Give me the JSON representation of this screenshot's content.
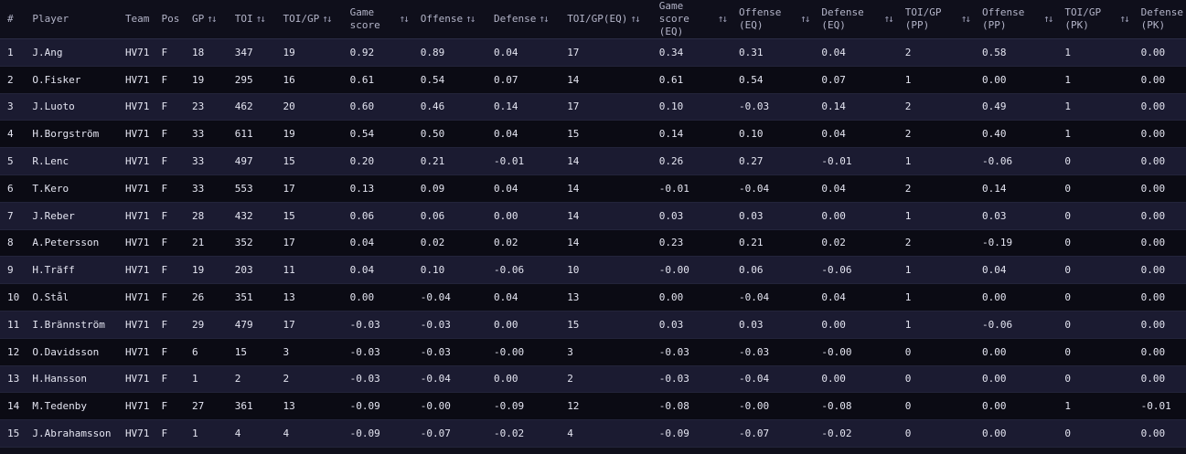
{
  "columns": [
    {
      "key": "rank",
      "label": "#",
      "sort": false
    },
    {
      "key": "player",
      "label": "Player",
      "sort": false
    },
    {
      "key": "team",
      "label": "Team",
      "sort": false
    },
    {
      "key": "pos",
      "label": "Pos",
      "sort": false
    },
    {
      "key": "gp",
      "label": "GP",
      "sort": true
    },
    {
      "key": "toi",
      "label": "TOI",
      "sort": true
    },
    {
      "key": "toi_gp",
      "label": "TOI/GP",
      "sort": true
    },
    {
      "key": "game_score",
      "label": "Game\nscore",
      "sort": true
    },
    {
      "key": "offense",
      "label": "Offense",
      "sort": true
    },
    {
      "key": "defense",
      "label": "Defense",
      "sort": true
    },
    {
      "key": "toi_gp_eq",
      "label": "TOI/GP(EQ)",
      "sort": true
    },
    {
      "key": "game_score_eq",
      "label": "Game\nscore\n(EQ)",
      "sort": true
    },
    {
      "key": "offense_eq",
      "label": "Offense\n(EQ)",
      "sort": true
    },
    {
      "key": "defense_eq",
      "label": "Defense\n(EQ)",
      "sort": true
    },
    {
      "key": "toi_gp_pp",
      "label": "TOI/GP\n(PP)",
      "sort": true
    },
    {
      "key": "offense_pp",
      "label": "Offense\n(PP)",
      "sort": true
    },
    {
      "key": "toi_gp_pk",
      "label": "TOI/GP\n(PK)",
      "sort": true
    },
    {
      "key": "defense_pk",
      "label": "Defense\n(PK)",
      "sort": false
    }
  ],
  "sort_icon": "up-down-arrows-icon",
  "rows": [
    [
      "1",
      "J.Ang",
      "HV71",
      "F",
      "18",
      "347",
      "19",
      "0.92",
      "0.89",
      "0.04",
      "17",
      "0.34",
      "0.31",
      "0.04",
      "2",
      "0.58",
      "1",
      "0.00"
    ],
    [
      "2",
      "O.Fisker",
      "HV71",
      "F",
      "19",
      "295",
      "16",
      "0.61",
      "0.54",
      "0.07",
      "14",
      "0.61",
      "0.54",
      "0.07",
      "1",
      "0.00",
      "1",
      "0.00"
    ],
    [
      "3",
      "J.Luoto",
      "HV71",
      "F",
      "23",
      "462",
      "20",
      "0.60",
      "0.46",
      "0.14",
      "17",
      "0.10",
      "-0.03",
      "0.14",
      "2",
      "0.49",
      "1",
      "0.00"
    ],
    [
      "4",
      "H.Borgström",
      "HV71",
      "F",
      "33",
      "611",
      "19",
      "0.54",
      "0.50",
      "0.04",
      "15",
      "0.14",
      "0.10",
      "0.04",
      "2",
      "0.40",
      "1",
      "0.00"
    ],
    [
      "5",
      "R.Lenc",
      "HV71",
      "F",
      "33",
      "497",
      "15",
      "0.20",
      "0.21",
      "-0.01",
      "14",
      "0.26",
      "0.27",
      "-0.01",
      "1",
      "-0.06",
      "0",
      "0.00"
    ],
    [
      "6",
      "T.Kero",
      "HV71",
      "F",
      "33",
      "553",
      "17",
      "0.13",
      "0.09",
      "0.04",
      "14",
      "-0.01",
      "-0.04",
      "0.04",
      "2",
      "0.14",
      "0",
      "0.00"
    ],
    [
      "7",
      "J.Reber",
      "HV71",
      "F",
      "28",
      "432",
      "15",
      "0.06",
      "0.06",
      "0.00",
      "14",
      "0.03",
      "0.03",
      "0.00",
      "1",
      "0.03",
      "0",
      "0.00"
    ],
    [
      "8",
      "A.Petersson",
      "HV71",
      "F",
      "21",
      "352",
      "17",
      "0.04",
      "0.02",
      "0.02",
      "14",
      "0.23",
      "0.21",
      "0.02",
      "2",
      "-0.19",
      "0",
      "0.00"
    ],
    [
      "9",
      "H.Träff",
      "HV71",
      "F",
      "19",
      "203",
      "11",
      "0.04",
      "0.10",
      "-0.06",
      "10",
      "-0.00",
      "0.06",
      "-0.06",
      "1",
      "0.04",
      "0",
      "0.00"
    ],
    [
      "10",
      "O.Stål",
      "HV71",
      "F",
      "26",
      "351",
      "13",
      "0.00",
      "-0.04",
      "0.04",
      "13",
      "0.00",
      "-0.04",
      "0.04",
      "1",
      "0.00",
      "0",
      "0.00"
    ],
    [
      "11",
      "I.Brännström",
      "HV71",
      "F",
      "29",
      "479",
      "17",
      "-0.03",
      "-0.03",
      "0.00",
      "15",
      "0.03",
      "0.03",
      "0.00",
      "1",
      "-0.06",
      "0",
      "0.00"
    ],
    [
      "12",
      "O.Davidsson",
      "HV71",
      "F",
      "6",
      "15",
      "3",
      "-0.03",
      "-0.03",
      "-0.00",
      "3",
      "-0.03",
      "-0.03",
      "-0.00",
      "0",
      "0.00",
      "0",
      "0.00"
    ],
    [
      "13",
      "H.Hansson",
      "HV71",
      "F",
      "1",
      "2",
      "2",
      "-0.03",
      "-0.04",
      "0.00",
      "2",
      "-0.03",
      "-0.04",
      "0.00",
      "0",
      "0.00",
      "0",
      "0.00"
    ],
    [
      "14",
      "M.Tedenby",
      "HV71",
      "F",
      "27",
      "361",
      "13",
      "-0.09",
      "-0.00",
      "-0.09",
      "12",
      "-0.08",
      "-0.00",
      "-0.08",
      "0",
      "0.00",
      "1",
      "-0.01"
    ],
    [
      "15",
      "J.Abrahamsson",
      "HV71",
      "F",
      "1",
      "4",
      "4",
      "-0.09",
      "-0.07",
      "-0.02",
      "4",
      "-0.09",
      "-0.07",
      "-0.02",
      "0",
      "0.00",
      "0",
      "0.00"
    ]
  ]
}
